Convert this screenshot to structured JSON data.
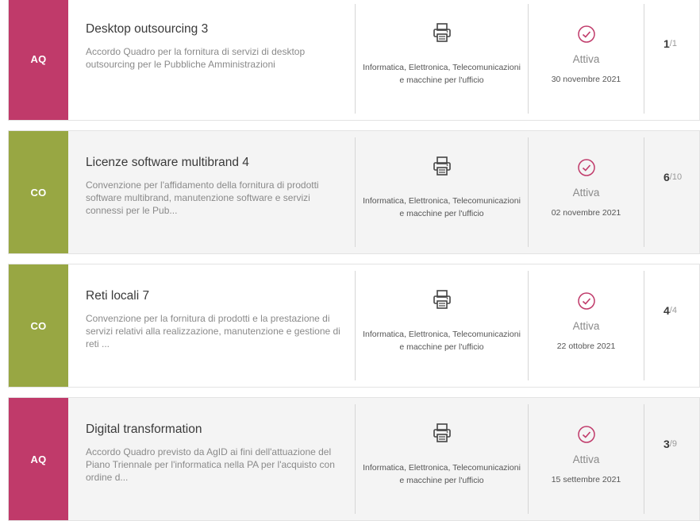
{
  "cards": [
    {
      "badge": "AQ",
      "badge_color": "#c03a6a",
      "title": "Desktop outsourcing 3",
      "description": "Accordo Quadro per la fornitura di servizi di desktop outsourcing per le Pubbliche Amministrazioni",
      "category": "Informatica, Elettronica, Telecomunicazioni e macchine per l'ufficio",
      "category_icon": "printer-icon",
      "status": "Attiva",
      "date": "30 novembre 2021",
      "count_current": "1",
      "count_total": "/1"
    },
    {
      "badge": "CO",
      "badge_color": "#98a743",
      "title": "Licenze software multibrand 4",
      "description": "Convenzione per l'affidamento della fornitura di prodotti software multibrand, manutenzione software e servizi connessi per le Pub...",
      "category": "Informatica, Elettronica, Telecomunicazioni e macchine per l'ufficio",
      "category_icon": "printer-icon",
      "status": "Attiva",
      "date": "02 novembre 2021",
      "count_current": "6",
      "count_total": "/10"
    },
    {
      "badge": "CO",
      "badge_color": "#98a743",
      "title": "Reti locali 7",
      "description": "Convenzione per la fornitura di prodotti e la prestazione di servizi relativi alla realizzazione, manutenzione e gestione di reti ...",
      "category": "Informatica, Elettronica, Telecomunicazioni e macchine per l'ufficio",
      "category_icon": "printer-icon",
      "status": "Attiva",
      "date": "22 ottobre 2021",
      "count_current": "4",
      "count_total": "/4"
    },
    {
      "badge": "AQ",
      "badge_color": "#c03a6a",
      "title": "Digital transformation",
      "description": "Accordo Quadro previsto da AgID ai fini dell'attuazione del Piano Triennale per l'informatica nella PA per l'acquisto con ordine d...",
      "category": "Informatica, Elettronica, Telecomunicazioni e macchine per l'ufficio",
      "category_icon": "printer-icon",
      "status": "Attiva",
      "date": "15 settembre 2021",
      "count_current": "3",
      "count_total": "/9"
    }
  ],
  "colors": {
    "status_icon": "#c03a6a",
    "card_alt_bg": "#f4f4f4"
  }
}
